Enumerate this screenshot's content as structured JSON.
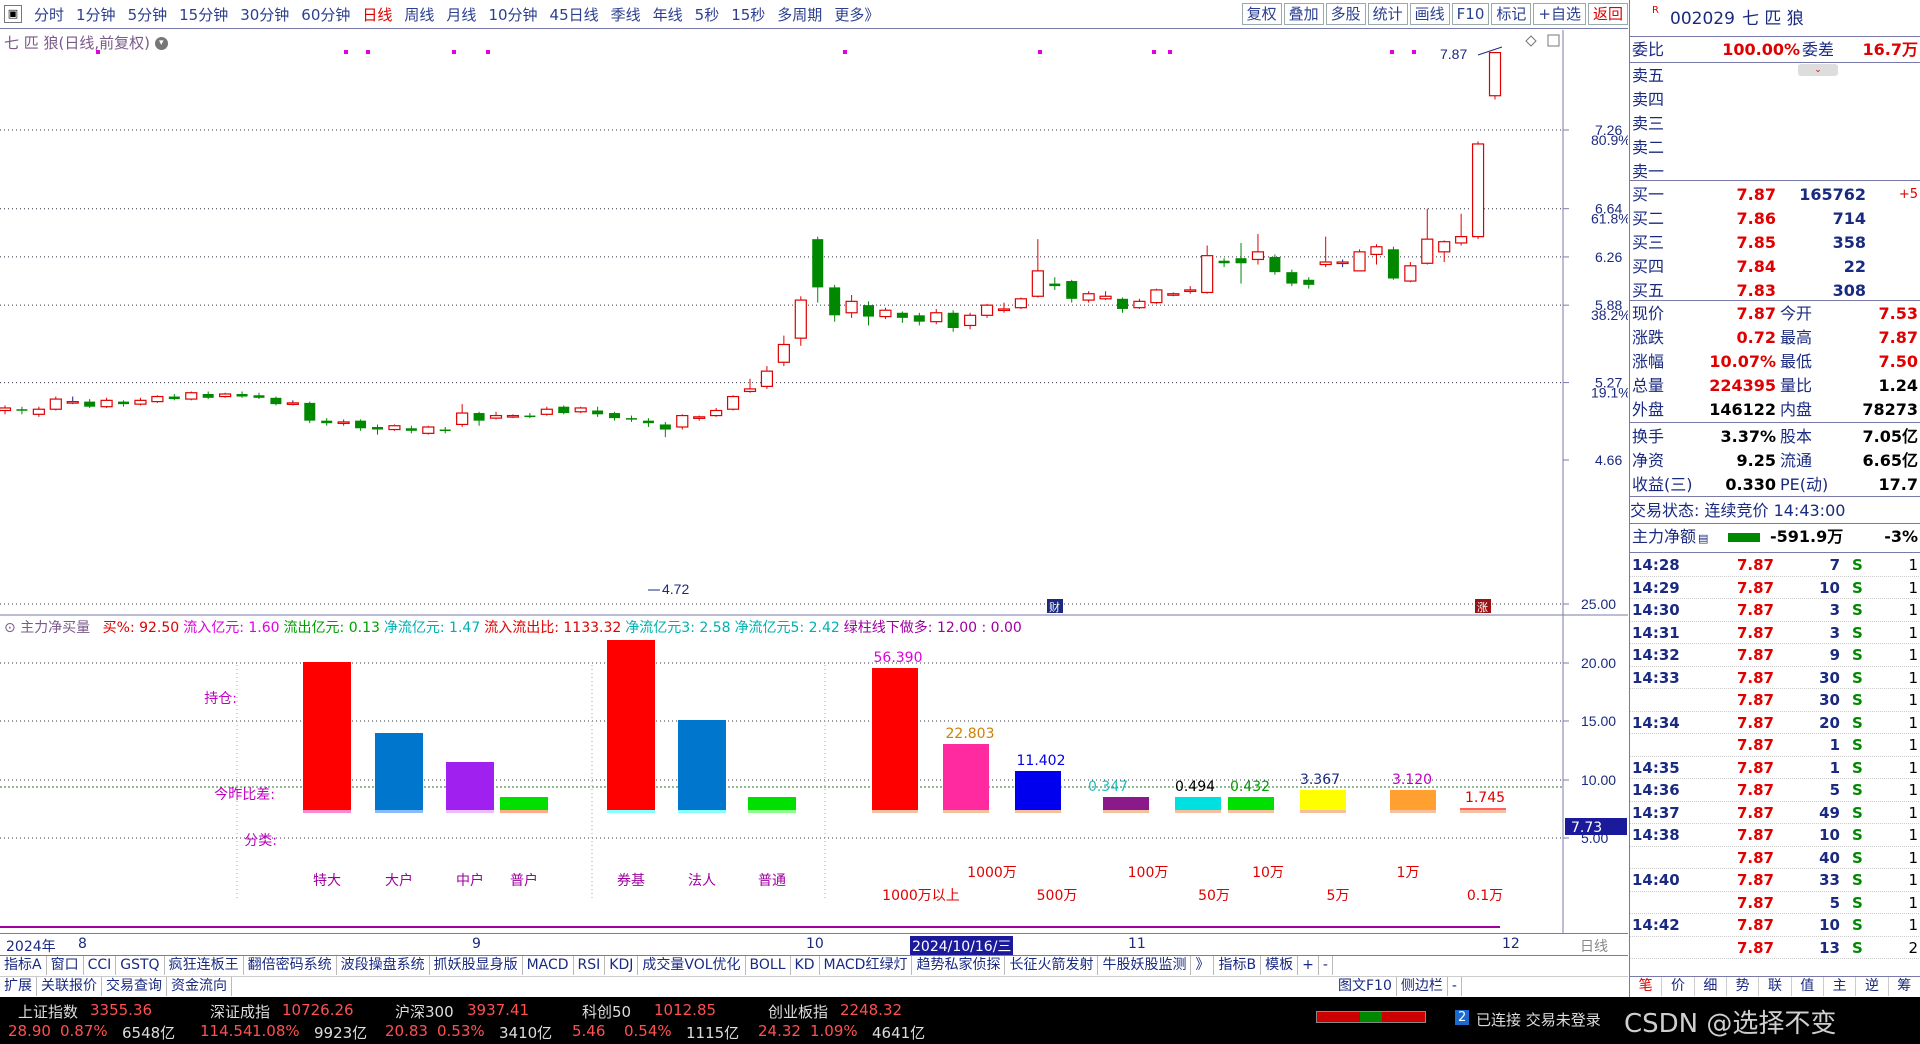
{
  "toolbar": {
    "periods": [
      "分时",
      "1分钟",
      "5分钟",
      "15分钟",
      "30分钟",
      "60分钟",
      "日线",
      "周线",
      "月线",
      "10分钟",
      "45日线",
      "季线",
      "年线",
      "5秒",
      "15秒",
      "多周期",
      "更多》"
    ],
    "active_period": "日线",
    "tools": [
      "复权",
      "叠加",
      "多股",
      "统计",
      "画线",
      "F10",
      "标记",
      "+自选",
      "返回"
    ]
  },
  "chart": {
    "header": "七 匹 狼(日线,前复权)",
    "price_labels": [
      "7.26",
      "6.64",
      "6.26",
      "5.88",
      "5.27",
      "4.66"
    ],
    "pct_labels": [
      "80.9%",
      "61.8%",
      "38.2%",
      "19.1%"
    ],
    "high_marker": "7.87",
    "low_marker": "4.72",
    "badge_cai": "财",
    "badge_zhang": "涨",
    "ind_axis": [
      "25.00",
      "20.00",
      "15.00",
      "10.00",
      "5.00"
    ],
    "ind_current": "7.73",
    "dates": [
      "2024年",
      "8",
      "9",
      "10",
      "2024/10/16/三",
      "11",
      "12"
    ],
    "period_tag": "日线"
  },
  "indicator": {
    "name": "主力净买量",
    "params": [
      {
        "text": "买%: 92.50",
        "color": "#e00000"
      },
      {
        "text": "流入亿元: 1.60",
        "color": "#e000e0"
      },
      {
        "text": "流出亿元: 0.13",
        "color": "#00a000"
      },
      {
        "text": "净流亿元: 1.47",
        "color": "#00b0b0"
      },
      {
        "text": "流入流出比: 1133.32",
        "color": "#e00000"
      },
      {
        "text": "净流亿元3: 2.58",
        "color": "#00b0b0"
      },
      {
        "text": "净流亿元5: 2.42",
        "color": "#00b0b0"
      },
      {
        "text": "绿柱线下做多: 12.00 : 0.00",
        "color": "#a000a0"
      }
    ],
    "left_labels": [
      "持仓:",
      "今昨比差:",
      "分类:"
    ],
    "categories": [
      "特大",
      "大户",
      "中户",
      "普户",
      "券基",
      "法人",
      "普通"
    ],
    "bar_values": [
      "56.390",
      "22.803",
      "11.402",
      "0.347",
      "0.494",
      "0.432",
      "3.367",
      "3.120",
      "1.745"
    ],
    "size_labels": [
      "1000万",
      "100万",
      "10万",
      "1万"
    ],
    "size_labels2": [
      "1000万以上",
      "500万",
      "50万",
      "5万",
      "0.1万"
    ]
  },
  "chart_data": {
    "type": "bar",
    "categories": [
      "1000万以上",
      "1000万",
      "500万",
      "100万",
      "50万",
      "10万",
      "5万",
      "1万",
      "0.1万"
    ],
    "values": [
      56.39,
      22.803,
      11.402,
      0.347,
      0.494,
      0.432,
      3.367,
      3.12,
      1.745
    ],
    "candles_close_trend": [
      4.98,
      5.04,
      7.87
    ]
  },
  "quote": {
    "code": "002029",
    "name": "七 匹 狼",
    "weibi_label": "委比",
    "weibi": "100.00%",
    "weicha_label": "委差",
    "weicha": "16.7万",
    "sells": [
      "卖五",
      "卖四",
      "卖三",
      "卖二",
      "卖一"
    ],
    "buys": [
      {
        "label": "买一",
        "price": "7.87",
        "vol": "165762",
        "chg": "+5"
      },
      {
        "label": "买二",
        "price": "7.86",
        "vol": "714",
        "chg": ""
      },
      {
        "label": "买三",
        "price": "7.85",
        "vol": "358",
        "chg": ""
      },
      {
        "label": "买四",
        "price": "7.84",
        "vol": "22",
        "chg": ""
      },
      {
        "label": "买五",
        "price": "7.83",
        "vol": "308",
        "chg": ""
      }
    ],
    "stats": [
      {
        "l1": "现价",
        "v1": "7.87",
        "l2": "今开",
        "v2": "7.53"
      },
      {
        "l1": "涨跌",
        "v1": "0.72",
        "l2": "最高",
        "v2": "7.87"
      },
      {
        "l1": "涨幅",
        "v1": "10.07%",
        "l2": "最低",
        "v2": "7.50"
      },
      {
        "l1": "总量",
        "v1": "224395",
        "l2": "量比",
        "v2": "1.24"
      },
      {
        "l1": "外盘",
        "v1": "146122",
        "l2": "内盘",
        "v2": "78273"
      }
    ],
    "stats2": [
      {
        "l1": "换手",
        "v1": "3.37%",
        "l2": "股本",
        "v2": "7.05亿"
      },
      {
        "l1": "净资",
        "v1": "9.25",
        "l2": "流通",
        "v2": "6.65亿"
      },
      {
        "l1": "收益(三)",
        "v1": "0.330",
        "l2": "PE(动)",
        "v2": "17.7"
      }
    ],
    "trade_status": "交易状态: 连续竞价 14:43:00",
    "main_flow_label": "主力净额",
    "main_flow": "-591.9万",
    "main_flow_pct": "-3%",
    "ticks": [
      {
        "t": "14:28",
        "p": "7.87",
        "v": "7",
        "s": "S",
        "n": "1"
      },
      {
        "t": "14:29",
        "p": "7.87",
        "v": "10",
        "s": "S",
        "n": "1"
      },
      {
        "t": "14:30",
        "p": "7.87",
        "v": "3",
        "s": "S",
        "n": "1"
      },
      {
        "t": "14:31",
        "p": "7.87",
        "v": "3",
        "s": "S",
        "n": "1"
      },
      {
        "t": "14:32",
        "p": "7.87",
        "v": "9",
        "s": "S",
        "n": "1"
      },
      {
        "t": "14:33",
        "p": "7.87",
        "v": "30",
        "s": "S",
        "n": "1"
      },
      {
        "t": "",
        "p": "7.87",
        "v": "30",
        "s": "S",
        "n": "1"
      },
      {
        "t": "14:34",
        "p": "7.87",
        "v": "20",
        "s": "S",
        "n": "1"
      },
      {
        "t": "",
        "p": "7.87",
        "v": "1",
        "s": "S",
        "n": "1"
      },
      {
        "t": "14:35",
        "p": "7.87",
        "v": "1",
        "s": "S",
        "n": "1"
      },
      {
        "t": "14:36",
        "p": "7.87",
        "v": "5",
        "s": "S",
        "n": "1"
      },
      {
        "t": "14:37",
        "p": "7.87",
        "v": "49",
        "s": "S",
        "n": "1"
      },
      {
        "t": "14:38",
        "p": "7.87",
        "v": "10",
        "s": "S",
        "n": "1"
      },
      {
        "t": "",
        "p": "7.87",
        "v": "40",
        "s": "S",
        "n": "1"
      },
      {
        "t": "14:40",
        "p": "7.87",
        "v": "33",
        "s": "S",
        "n": "1"
      },
      {
        "t": "",
        "p": "7.87",
        "v": "5",
        "s": "S",
        "n": "1"
      },
      {
        "t": "14:42",
        "p": "7.87",
        "v": "10",
        "s": "S",
        "n": "1"
      },
      {
        "t": "",
        "p": "7.87",
        "v": "13",
        "s": "S",
        "n": "2"
      }
    ],
    "bottom_tabs": [
      "笔",
      "价",
      "细",
      "势",
      "联",
      "值",
      "主",
      "逆",
      "筹"
    ]
  },
  "tabs1": [
    "指标A",
    "窗口",
    "CCI",
    "GSTQ",
    "疯狂连板王",
    "翻倍密码系统",
    "波段操盘系统",
    "抓妖股显身版",
    "MACD",
    "RSI",
    "KDJ",
    "成交量VOL优化",
    "BOLL",
    "KD",
    "MACD红绿灯",
    "趋势私家侦探",
    "长征火箭发射",
    "牛股妖股监测",
    "》",
    "指标B",
    "模板",
    "+",
    "-"
  ],
  "tabs2": [
    "扩展",
    "关联报价",
    "交易查询",
    "资金流向",
    "图文F10",
    "侧边栏",
    "-"
  ],
  "status": {
    "indices": [
      {
        "name": "上证指数",
        "val": "3355.36",
        "chg": "28.90",
        "pct": "0.87%",
        "amt": "6548亿"
      },
      {
        "name": "深证成指",
        "val": "10726.26",
        "chg": "114.54",
        "pct": "1.08%",
        "amt": "9923亿"
      },
      {
        "name": "沪深300",
        "val": "3937.41",
        "chg": "20.83",
        "pct": "0.53%",
        "amt": "3410亿"
      },
      {
        "name": "科创50",
        "val": "1012.85",
        "chg": "5.46",
        "pct": "0.54%",
        "amt": "1115亿"
      },
      {
        "name": "创业板指",
        "val": "2248.32",
        "chg": "24.32",
        "pct": "1.09%",
        "amt": "4641亿"
      }
    ],
    "conn_num": "2",
    "conn_text": "已连接 交易未登录",
    "watermark": "CSDN @选择不变"
  }
}
